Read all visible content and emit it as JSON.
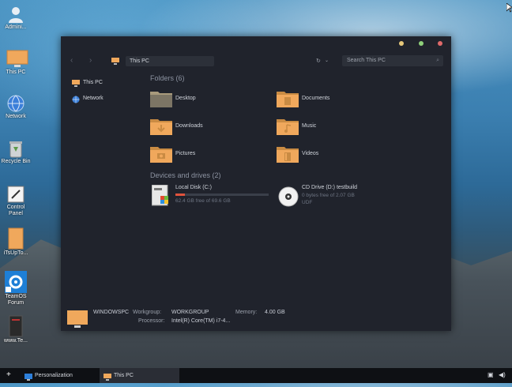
{
  "desktop": {
    "icons": [
      {
        "label": "Admini...",
        "icon": "user-icon"
      },
      {
        "label": "This PC",
        "icon": "monitor-icon"
      },
      {
        "label": "Network",
        "icon": "network-globe-icon"
      },
      {
        "label": "Recycle Bin",
        "icon": "recycle-bin-icon"
      },
      {
        "label": "Control Panel",
        "icon": "control-panel-icon"
      },
      {
        "label": "iTsUpTo...",
        "icon": "file-icon"
      },
      {
        "label": "TeamOS Forum",
        "icon": "gear-icon"
      },
      {
        "label": "www.Te...",
        "icon": "book-icon"
      }
    ]
  },
  "window": {
    "title_dots_colors": [
      "#e6c77a",
      "#8fd07a",
      "#e06a6a"
    ],
    "toolbar": {
      "back_icon": "chevron-left-icon",
      "forward_icon": "chevron-right-icon",
      "breadcrumb": "This PC",
      "refresh_icon": "refresh-icon",
      "search_placeholder": "Search This PC"
    },
    "sidebar": [
      {
        "label": "This PC",
        "icon": "monitor-icon"
      },
      {
        "label": "Network",
        "icon": "network-globe-icon"
      }
    ],
    "folders_title": "Folders (6)",
    "folders": [
      {
        "label": "Desktop",
        "icon": "desktop-folder-icon"
      },
      {
        "label": "Documents",
        "icon": "documents-folder-icon"
      },
      {
        "label": "Downloads",
        "icon": "downloads-folder-icon"
      },
      {
        "label": "Music",
        "icon": "music-folder-icon"
      },
      {
        "label": "Pictures",
        "icon": "pictures-folder-icon"
      },
      {
        "label": "Videos",
        "icon": "videos-folder-icon"
      }
    ],
    "drives_title": "Devices and drives (2)",
    "drives": [
      {
        "name": "Local Disk (C:)",
        "free": "62.4 GB free of 69.6 GB",
        "used_fraction": 0.1,
        "icon": "hard-disk-icon"
      },
      {
        "name": "CD Drive (D:) testbuild",
        "free": "0 bytes free of 2.07 GB",
        "fs": "UDF",
        "icon": "cd-drive-icon"
      }
    ],
    "details": {
      "computer_name": "WINDOWSPC",
      "workgroup_label": "Workgroup:",
      "workgroup_value": "WORKGROUP",
      "memory_label": "Memory:",
      "memory_value": "4.00 GB",
      "processor_label": "Processor:",
      "processor_value": "Intel(R) Core(TM) i7-4..."
    }
  },
  "taskbar": {
    "start_icon": "start-icon",
    "items": [
      {
        "label": "Personalization",
        "icon": "personalization-icon"
      },
      {
        "label": "This PC",
        "icon": "monitor-icon"
      }
    ],
    "tray": [
      "network-tray-icon",
      "volume-icon"
    ]
  },
  "colors": {
    "accent_folder": "#e6a95a",
    "window_bg": "#20232c",
    "disk_bar": "#e0533d"
  }
}
